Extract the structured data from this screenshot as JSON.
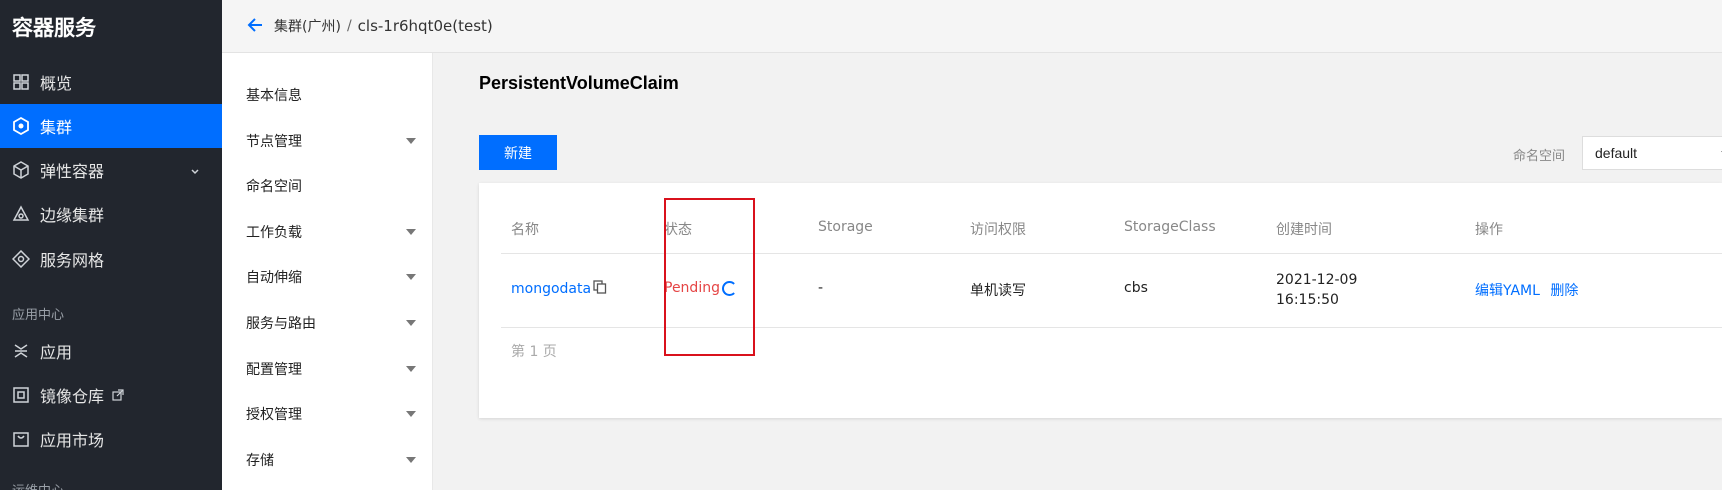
{
  "sidebar": {
    "brand": "容器服务",
    "items": [
      {
        "label": "概览",
        "icon": "grid-icon"
      },
      {
        "label": "集群",
        "icon": "hexagon-icon",
        "active": true
      },
      {
        "label": "弹性容器",
        "icon": "cube-icon",
        "expandable": true
      },
      {
        "label": "边缘集群",
        "icon": "edge-cluster-icon"
      },
      {
        "label": "服务网格",
        "icon": "mesh-icon"
      }
    ],
    "group_label": "应用中心",
    "app_items": [
      {
        "label": "应用",
        "icon": "app-icon"
      },
      {
        "label": "镜像仓库",
        "icon": "registry-icon",
        "external": true
      },
      {
        "label": "应用市场",
        "icon": "market-icon"
      }
    ],
    "partial_bottom": "运维中心"
  },
  "header": {
    "breadcrumb_parent": "集群(广州)",
    "separator": "/",
    "current": "cls-1r6hqt0e(test)"
  },
  "submenu": {
    "items": [
      {
        "label": "基本信息",
        "has_arrow": false
      },
      {
        "label": "节点管理",
        "has_arrow": true
      },
      {
        "label": "命名空间",
        "has_arrow": false
      },
      {
        "label": "工作负载",
        "has_arrow": true
      },
      {
        "label": "自动伸缩",
        "has_arrow": true
      },
      {
        "label": "服务与路由",
        "has_arrow": true
      },
      {
        "label": "配置管理",
        "has_arrow": true
      },
      {
        "label": "授权管理",
        "has_arrow": true
      },
      {
        "label": "存储",
        "has_arrow": true
      }
    ]
  },
  "main": {
    "title": "PersistentVolumeClaim",
    "new_button": "新建",
    "namespace_label": "命名空间",
    "namespace_value": "default",
    "columns": [
      "名称",
      "状态",
      "Storage",
      "访问权限",
      "StorageClass",
      "创建时间",
      "操作"
    ],
    "row": {
      "name": "mongodata",
      "status": "Pending",
      "storage": "-",
      "access": "单机读写",
      "storage_class": "cbs",
      "created_date": "2021-12-09",
      "created_time": "16:15:50",
      "action_edit": "编辑YAML",
      "action_delete": "删除"
    },
    "pager": "第 1 页"
  },
  "colors": {
    "accent": "#006eff",
    "nav_bg": "#22262e",
    "status_pending": "#e54545",
    "highlight_box": "#d9111c"
  }
}
